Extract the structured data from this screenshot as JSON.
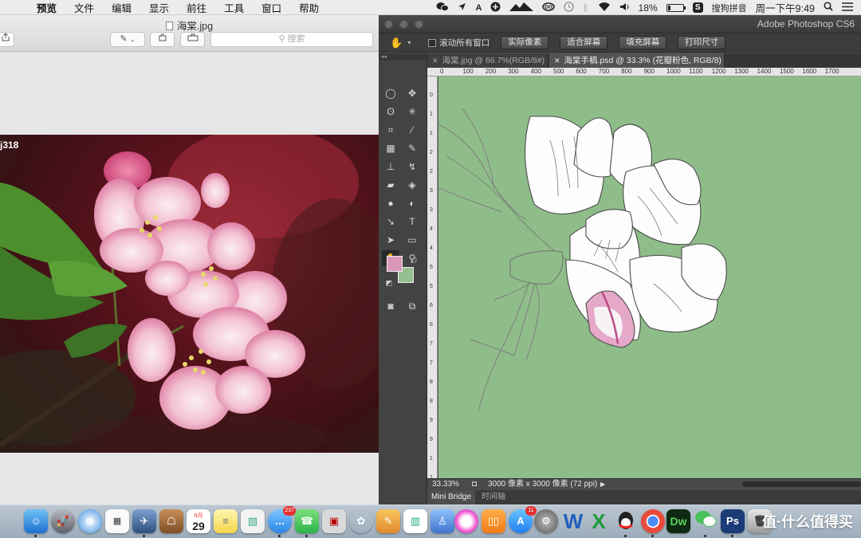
{
  "menubar": {
    "app_name": "预览",
    "items": [
      "文件",
      "编辑",
      "显示",
      "前往",
      "工具",
      "窗口",
      "帮助"
    ],
    "battery_percent": "18%",
    "battery_level": 0.18,
    "ime_label": "搜狗拼音",
    "clock": "周一下午9:49",
    "status_icons": [
      "wechat-icon",
      "location-icon",
      "adobe-icon",
      "plus-icon",
      "mountain-icon",
      "creative-cloud-icon",
      "time-machine-icon",
      "bluetooth-icon",
      "wifi-icon",
      "volume-icon",
      "battery-icon",
      "sogou-icon",
      "search-icon",
      "list-icon"
    ]
  },
  "preview": {
    "title": "海棠.jpg",
    "search_placeholder": "搜索",
    "photo_watermark": "j318"
  },
  "photoshop": {
    "app_title": "Adobe Photoshop CS6",
    "options": {
      "scroll_all_windows": "滚动所有窗口",
      "buttons": [
        "实际像素",
        "适合屏幕",
        "填充屏幕",
        "打印尺寸"
      ]
    },
    "tabs": [
      {
        "label": "海棠.jpg @ 66.7%(RGB/8#)",
        "active": false
      },
      {
        "label": "海棠手稿.psd @ 33.3% (花瓣粉色, RGB/8)",
        "active": true
      }
    ],
    "ruler_top": [
      "0",
      "100",
      "200",
      "300",
      "400",
      "500",
      "600",
      "700",
      "800",
      "900",
      "1000",
      "1100",
      "1200",
      "1300",
      "1400",
      "1500",
      "1600",
      "1700"
    ],
    "ruler_left": [
      "0",
      "1",
      "1",
      "2",
      "2",
      "3",
      "3",
      "4",
      "4",
      "5",
      "5",
      "6",
      "6",
      "7",
      "7",
      "8",
      "8",
      "9",
      "9",
      "1",
      "1"
    ],
    "foreground_color": "#d998b8",
    "background_color": "#95c08f",
    "canvas_color": "#8fbd89",
    "status": {
      "zoom": "33.33%",
      "doc_info": "3000 像素 x 3000 像素 (72 ppi)"
    },
    "bottom_tabs": [
      "Mini Bridge",
      "时间轴"
    ]
  },
  "dock": {
    "calendar_month": "9月",
    "calendar_day": "29",
    "badges": {
      "messages": "237",
      "appstore": "11"
    },
    "watermark": "值·什么值得买"
  }
}
